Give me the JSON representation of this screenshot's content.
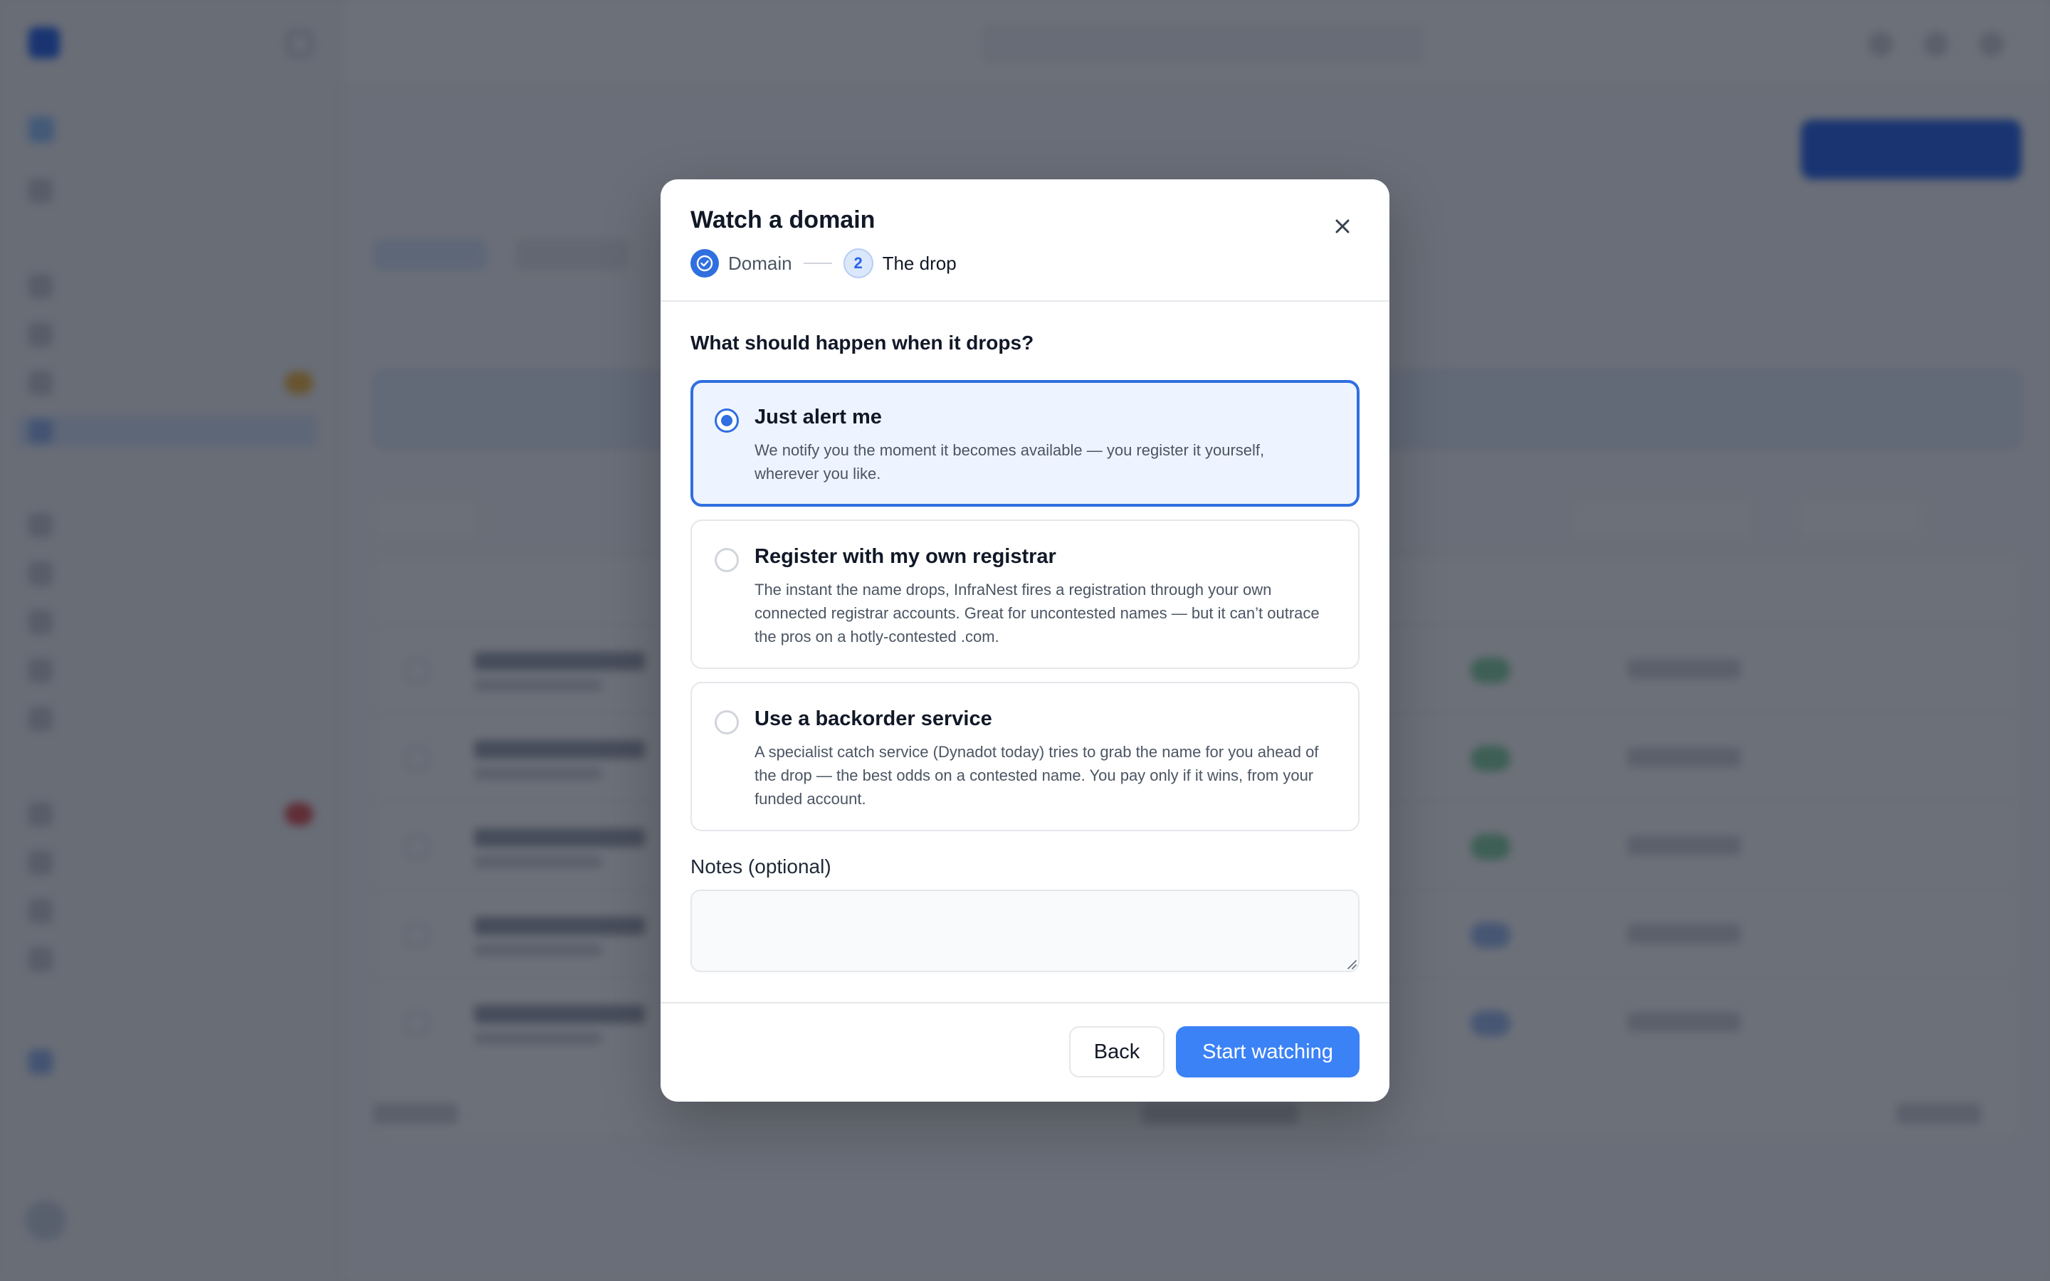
{
  "modal": {
    "title": "Watch a domain",
    "stepper": {
      "step1_label": "Domain",
      "step2_number": "2",
      "step2_label": "The drop"
    },
    "question": "What should happen when it drops?",
    "options": [
      {
        "title": "Just alert me",
        "description": "We notify you the moment it becomes available — you register it yourself, wherever you like.",
        "selected": true
      },
      {
        "title": "Register with my own registrar",
        "description": "The instant the name drops, InfraNest fires a registration through your own connected registrar accounts. Great for uncontested names — but it can’t outrace the pros on a hotly-contested .com.",
        "selected": false
      },
      {
        "title": "Use a backorder service",
        "description": "A specialist catch service (Dynadot today) tries to grab the name for you ahead of the drop — the best odds on a contested name. You pay only if it wins, from your funded account.",
        "selected": false
      }
    ],
    "notes_label": "Notes (optional)",
    "notes_value": "",
    "buttons": {
      "back": "Back",
      "start": "Start watching"
    }
  },
  "colors": {
    "accent": "#2f6fe0",
    "primary_button": "#3b82f6",
    "overlay": "rgba(17,24,39,0.62)"
  },
  "icons": {
    "close": "close-icon",
    "step_done": "check-circle-icon"
  }
}
